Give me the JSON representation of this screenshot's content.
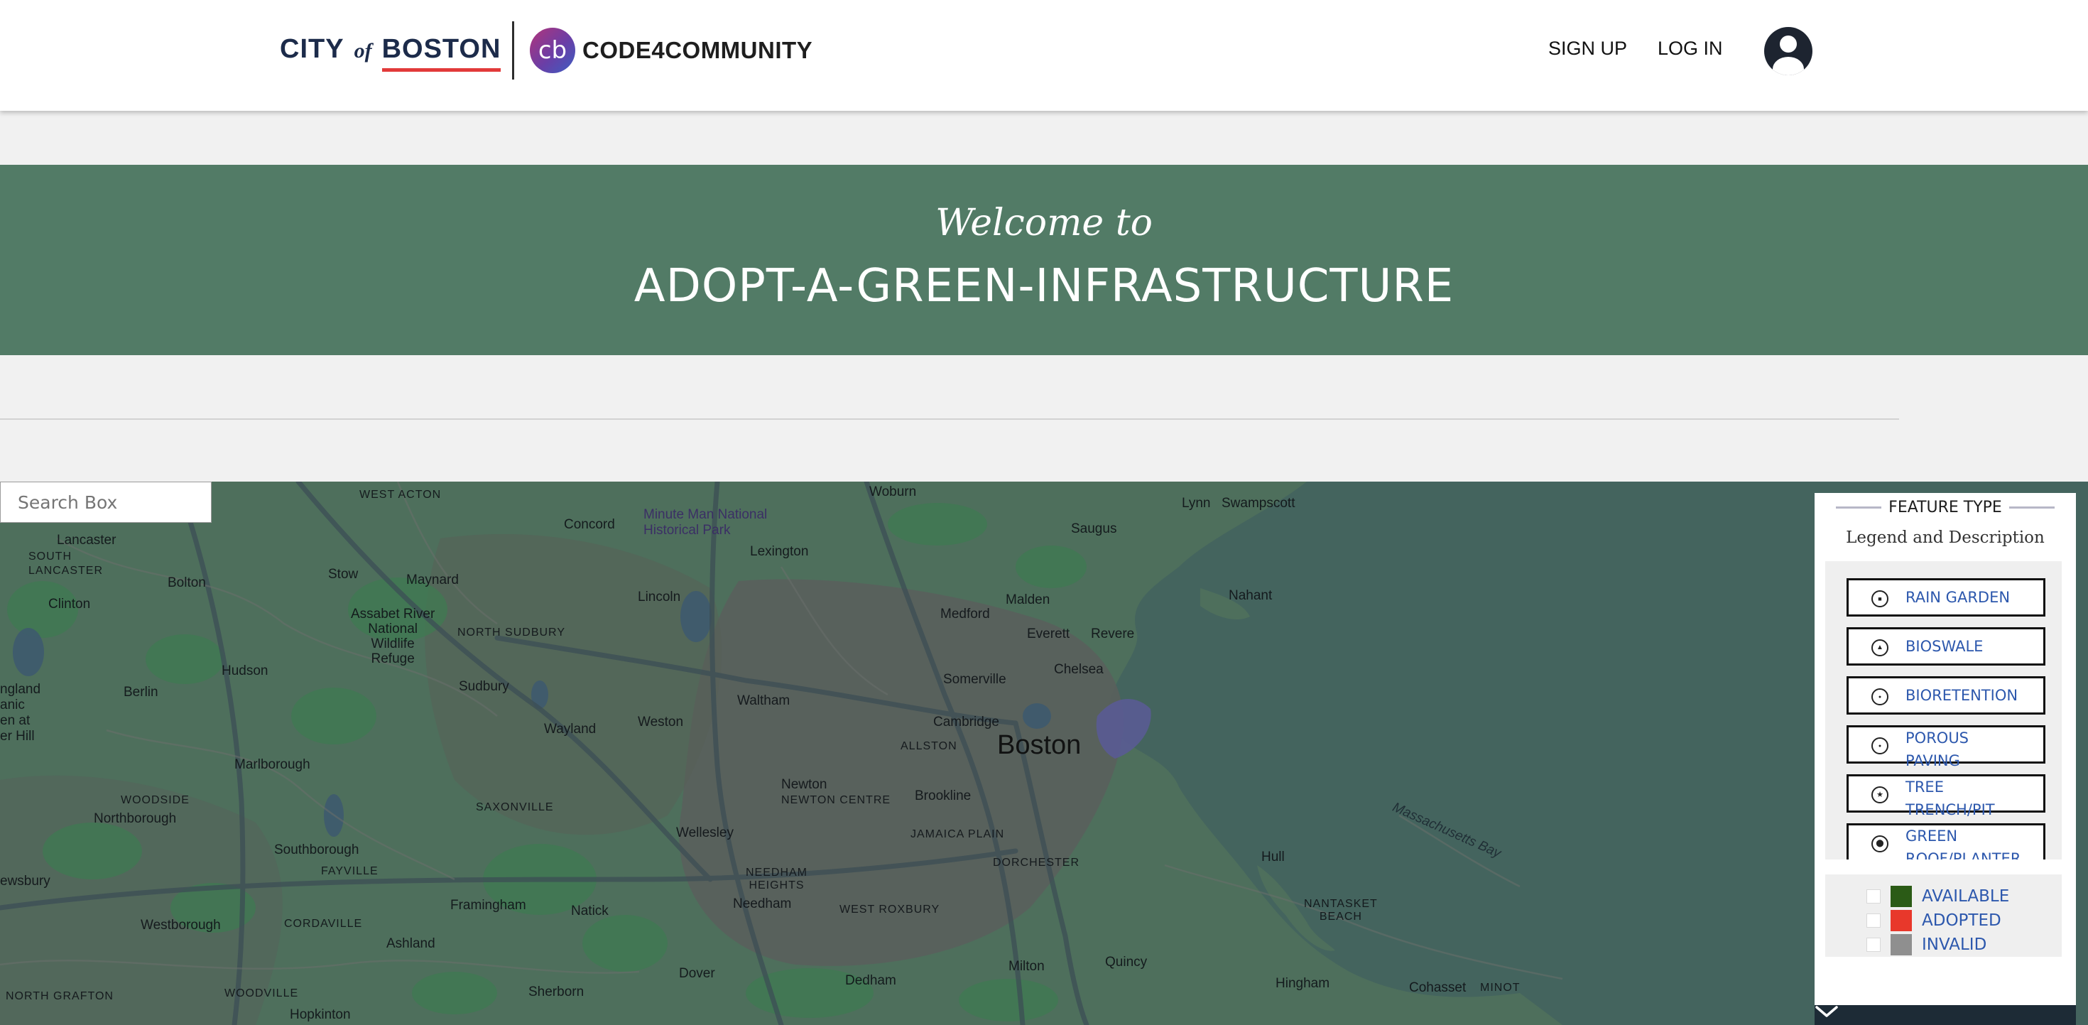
{
  "header": {
    "boston_logo": {
      "city": "CITY",
      "of": "of",
      "boston": "BOSTON"
    },
    "partner_logo": {
      "mark": "cb",
      "name": "CODE4COMMUNITY"
    },
    "nav": {
      "sign_up": "SIGN UP",
      "log_in": "LOG IN"
    },
    "avatar_icon": "account-circle-icon"
  },
  "banner": {
    "welcome": "Welcome to",
    "title": "ADOPT-A-GREEN-INFRASTRUCTURE",
    "background_color": "#527b66"
  },
  "map": {
    "search": {
      "placeholder": "Search Box"
    },
    "labels": {
      "woburn": "Woburn",
      "lynn": "Lynn",
      "swampscott": "Swampscott",
      "west_acton": "WEST ACTON",
      "lancaster": "Lancaster",
      "south_lancaster": "SOUTH\nLANCASTER",
      "concord": "Concord",
      "minute_man": "Minute Man National\nHistorical Park",
      "saugus": "Saugus",
      "lexington": "Lexington",
      "stow": "Stow",
      "maynard": "Maynard",
      "bolton": "Bolton",
      "clinton": "Clinton",
      "lincoln": "Lincoln",
      "medford": "Medford",
      "malden": "Malden",
      "nahant": "Nahant",
      "assabet": "Assabet River\nNational\nWildlife\nRefuge",
      "north_sudbury": "NORTH SUDBURY",
      "everett": "Everett",
      "revere": "Revere",
      "hudson": "Hudson",
      "chelsea": "Chelsea",
      "berlin": "Berlin",
      "sudbury": "Sudbury",
      "waltham": "Waltham",
      "somerville": "Somerville",
      "england_frag": "ngland\nanic\nen at\ner Hill",
      "wayland": "Wayland",
      "weston": "Weston",
      "cambridge": "Cambridge",
      "allston": "ALLSTON",
      "boston": "Boston",
      "marlborough": "Marlborough",
      "woodside": "WOODSIDE",
      "newton": "Newton",
      "newton_centre": "NEWTON CENTRE",
      "northborough": "Northborough",
      "saxonville": "SAXONVILLE",
      "brookline": "Brookline",
      "mass_bay": "Massachusetts Bay",
      "wellesley": "Wellesley",
      "jamaica_plain": "JAMAICA PLAIN",
      "southborough": "Southborough",
      "fayville": "FAYVILLE",
      "hull": "Hull",
      "dorchester": "DORCHESTER",
      "needham_heights": "NEEDHAM\nHEIGHTS",
      "ewsbury": "ewsbury",
      "framingham": "Framingham",
      "natick": "Natick",
      "needham": "Needham",
      "nantasket": "NANTASKET\nBEACH",
      "west_roxbury": "WEST ROXBURY",
      "westborough": "Westborough",
      "cordaville": "CORDAVILLE",
      "ashland": "Ashland",
      "milton": "Milton",
      "quincy": "Quincy",
      "dover": "Dover",
      "hingham": "Hingham",
      "dedham": "Dedham",
      "cohasset": "Cohasset",
      "minot": "MINOT",
      "north_grafton": "NORTH GRAFTON",
      "woodville": "WOODVILLE",
      "sherborn": "Sherborn",
      "hopkinton": "Hopkinton"
    }
  },
  "legend": {
    "heading": "FEATURE TYPE",
    "subheading": "Legend and Description",
    "features": [
      {
        "label": "RAIN GARDEN",
        "icon": "square-dot-icon",
        "glyph": "■"
      },
      {
        "label": "BIOSWALE",
        "icon": "triangle-icon",
        "glyph": "▲"
      },
      {
        "label": "BIORETENTION",
        "icon": "dot-icon",
        "glyph": "●"
      },
      {
        "label": "POROUS\nPAVING",
        "icon": "dot-icon",
        "glyph": "●"
      },
      {
        "label": "TREE\nTRENCH/PIT",
        "icon": "star-icon",
        "glyph": "★"
      },
      {
        "label": "GREEN\nROOF/PLANTER",
        "icon": "big-dot-icon",
        "glyph": "⬤"
      }
    ],
    "statuses": [
      {
        "label": "AVAILABLE",
        "color": "#2b5b16"
      },
      {
        "label": "ADOPTED",
        "color": "#e8382b"
      },
      {
        "label": "INVALID",
        "color": "#8f8f8f"
      }
    ],
    "toggle_icon": "chevron-down-icon"
  }
}
